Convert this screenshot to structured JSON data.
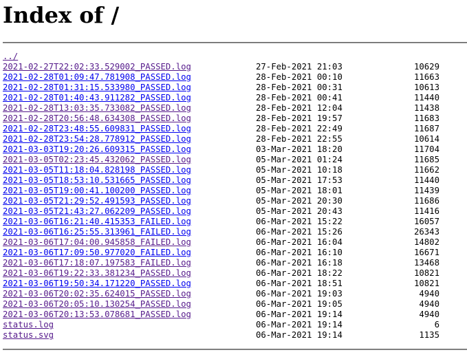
{
  "page": {
    "title": "Index of /"
  },
  "parent_link": {
    "label": "../",
    "visited": true
  },
  "files": [
    {
      "name": "2021-02-27T22:02:33.529002_PASSED.log",
      "date": "27-Feb-2021 21:03",
      "size": "10629",
      "visited": true
    },
    {
      "name": "2021-02-28T01:09:47.781908_PASSED.log",
      "date": "28-Feb-2021 00:10",
      "size": "11663",
      "visited": false
    },
    {
      "name": "2021-02-28T01:31:15.533980_PASSED.log",
      "date": "28-Feb-2021 00:31",
      "size": "10613",
      "visited": false
    },
    {
      "name": "2021-02-28T01:40:43.911282_PASSED.log",
      "date": "28-Feb-2021 00:41",
      "size": "11440",
      "visited": false
    },
    {
      "name": "2021-02-28T13:03:35.733082_PASSED.log",
      "date": "28-Feb-2021 12:04",
      "size": "11438",
      "visited": true
    },
    {
      "name": "2021-02-28T20:56:48.634308_PASSED.log",
      "date": "28-Feb-2021 19:57",
      "size": "11683",
      "visited": true
    },
    {
      "name": "2021-02-28T23:48:55.609831_PASSED.log",
      "date": "28-Feb-2021 22:49",
      "size": "11687",
      "visited": false
    },
    {
      "name": "2021-02-28T23:54:28.778912_PASSED.log",
      "date": "28-Feb-2021 22:55",
      "size": "10614",
      "visited": false
    },
    {
      "name": "2021-03-03T19:20:26.609315_PASSED.log",
      "date": "03-Mar-2021 18:20",
      "size": "11704",
      "visited": false
    },
    {
      "name": "2021-03-05T02:23:45.432062_PASSED.log",
      "date": "05-Mar-2021 01:24",
      "size": "11685",
      "visited": true
    },
    {
      "name": "2021-03-05T11:18:04.828198_PASSED.log",
      "date": "05-Mar-2021 10:18",
      "size": "11662",
      "visited": false
    },
    {
      "name": "2021-03-05T18:53:10.531665_PASSED.log",
      "date": "05-Mar-2021 17:53",
      "size": "11440",
      "visited": false
    },
    {
      "name": "2021-03-05T19:00:41.100200_PASSED.log",
      "date": "05-Mar-2021 18:01",
      "size": "11439",
      "visited": false
    },
    {
      "name": "2021-03-05T21:29:52.491593_PASSED.log",
      "date": "05-Mar-2021 20:30",
      "size": "11686",
      "visited": false
    },
    {
      "name": "2021-03-05T21:43:27.062209_PASSED.log",
      "date": "05-Mar-2021 20:43",
      "size": "11416",
      "visited": false
    },
    {
      "name": "2021-03-06T16:21:40.415353_FAILED.log",
      "date": "06-Mar-2021 15:22",
      "size": "16057",
      "visited": false
    },
    {
      "name": "2021-03-06T16:25:55.313961_FAILED.log",
      "date": "06-Mar-2021 15:26",
      "size": "26343",
      "visited": false
    },
    {
      "name": "2021-03-06T17:04:00.945858_FAILED.log",
      "date": "06-Mar-2021 16:04",
      "size": "14802",
      "visited": true
    },
    {
      "name": "2021-03-06T17:09:50.977020_FAILED.log",
      "date": "06-Mar-2021 16:10",
      "size": "16671",
      "visited": false
    },
    {
      "name": "2021-03-06T17:18:07.197583_FAILED.log",
      "date": "06-Mar-2021 16:18",
      "size": "13468",
      "visited": true
    },
    {
      "name": "2021-03-06T19:22:33.381234_PASSED.log",
      "date": "06-Mar-2021 18:22",
      "size": "10821",
      "visited": true
    },
    {
      "name": "2021-03-06T19:50:34.171220_PASSED.log",
      "date": "06-Mar-2021 18:51",
      "size": "10821",
      "visited": false
    },
    {
      "name": "2021-03-06T20:02:35.624015_PASSED.log",
      "date": "06-Mar-2021 19:03",
      "size": "4940",
      "visited": true
    },
    {
      "name": "2021-03-06T20:05:10.130254_PASSED.log",
      "date": "06-Mar-2021 19:05",
      "size": "4940",
      "visited": true
    },
    {
      "name": "2021-03-06T20:13:53.078681_PASSED.log",
      "date": "06-Mar-2021 19:14",
      "size": "4940",
      "visited": true
    },
    {
      "name": "status.log",
      "date": "06-Mar-2021 19:14",
      "size": "6",
      "visited": true
    },
    {
      "name": "status.svg",
      "date": "06-Mar-2021 19:14",
      "size": "1135",
      "visited": true
    }
  ],
  "colors": {
    "link_unvisited": "#0000ee",
    "link_visited": "#551a8b"
  }
}
